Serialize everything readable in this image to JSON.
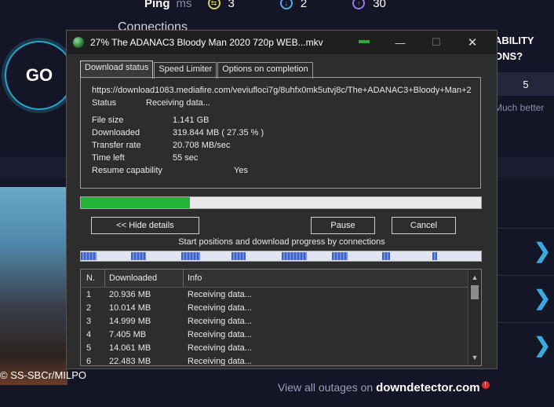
{
  "background": {
    "ping": {
      "label": "Ping",
      "unit": "ms",
      "jitter_glyph": "⇆",
      "jitter": "3",
      "download_glyph": "↓",
      "download": "2",
      "upload_glyph": "↑",
      "upload": "30"
    },
    "connections_label": "Connections",
    "go_label": "GO",
    "capability_line1": "ABILITY",
    "capability_line2": "ONS?",
    "number_value": "5",
    "much_better": "Much better",
    "image_credit": "© SS-SBCr/MILPO",
    "outages_prefix": "View all outages on ",
    "outages_brand": "downdetector.com",
    "outages_badge": "!",
    "chevron_glyph": "❯"
  },
  "window": {
    "title": "27% The ADANAC3 Bloody Man 2020 720p WEB...mkv",
    "minimize_glyph": "—",
    "maximize_glyph": "☐",
    "close_glyph": "✕",
    "tabs": [
      {
        "label": "Download status"
      },
      {
        "label": "Speed Limiter"
      },
      {
        "label": "Options on completion"
      }
    ],
    "url": "https://download1083.mediafire.com/veviufloci7g/8uhfx0mk5utvj8c/The+ADANAC3+Bloody+Man+2",
    "status_label": "Status",
    "status_value": "Receiving data...",
    "file_size_label": "File size",
    "file_size_value": "1.141  GB",
    "downloaded_label": "Downloaded",
    "downloaded_value": "319.844  MB  ( 27.35 % )",
    "transfer_rate_label": "Transfer rate",
    "transfer_rate_value": "20.708  MB/sec",
    "time_left_label": "Time left",
    "time_left_value": "55 sec",
    "resume_label": "Resume capability",
    "resume_value": "Yes",
    "progress_fraction": 0.2735,
    "hide_details_label": "<< Hide details",
    "pause_label": "Pause",
    "cancel_label": "Cancel",
    "connections_caption": "Start positions and download progress by connections",
    "table_headers": {
      "n": "N.",
      "downloaded": "Downloaded",
      "info": "Info"
    },
    "scroll_up_glyph": "▲",
    "scroll_down_glyph": "▼",
    "rows": [
      {
        "n": "1",
        "downloaded": "20.936  MB",
        "info": "Receiving data..."
      },
      {
        "n": "2",
        "downloaded": "10.014  MB",
        "info": "Receiving data..."
      },
      {
        "n": "3",
        "downloaded": "14.999  MB",
        "info": "Receiving data..."
      },
      {
        "n": "4",
        "downloaded": "7.405  MB",
        "info": "Receiving data..."
      },
      {
        "n": "5",
        "downloaded": "14.061  MB",
        "info": "Receiving data..."
      },
      {
        "n": "6",
        "downloaded": "22.483  MB",
        "info": "Receiving data..."
      }
    ]
  },
  "colors": {
    "accent_green": "#22b33a",
    "segment_blue": "#3f5fbf",
    "chevron_blue": "#3aa9e0"
  }
}
